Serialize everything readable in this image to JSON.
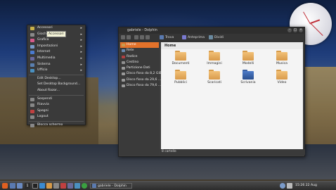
{
  "menu": {
    "items": [
      {
        "label": "Accessori",
        "submenu": true,
        "icon": "accessories-icon",
        "color": "#c9b24a"
      },
      {
        "label": "Giochi",
        "submenu": true,
        "icon": "games-icon",
        "color": "#8a8a8a"
      },
      {
        "label": "Grafica",
        "submenu": true,
        "icon": "graphics-icon",
        "color": "#d45a8a"
      },
      {
        "label": "Impostazioni",
        "submenu": true,
        "icon": "settings-icon",
        "color": "#7a9ac8"
      },
      {
        "label": "Internet",
        "submenu": true,
        "icon": "internet-icon",
        "color": "#4a7ad0"
      },
      {
        "label": "Multimedia",
        "submenu": true,
        "icon": "multimedia-icon",
        "color": "#6a6aa0"
      },
      {
        "label": "Sistema",
        "submenu": true,
        "icon": "system-icon",
        "color": "#5a80b0"
      },
      {
        "label": "Ufficio",
        "submenu": true,
        "icon": "office-icon",
        "color": "#4a90c0"
      }
    ],
    "extra_items": [
      "Edit Desktop...",
      "Set Desktop Background...",
      "About Razor..."
    ],
    "session_items": [
      {
        "label": "Sospendi",
        "icon": "suspend-icon"
      },
      {
        "label": "Riavvia",
        "icon": "restart-icon"
      },
      {
        "label": "Spegni",
        "icon": "shutdown-icon"
      },
      {
        "label": "Logout",
        "icon": "logout-icon"
      }
    ],
    "lock_item": {
      "label": "Blocca schermo",
      "icon": "lock-icon"
    },
    "tooltip": "Accessori"
  },
  "window": {
    "title": "gabriele - Dolphin",
    "toolbar": {
      "search": "Trova",
      "preview": "Anteprima",
      "split": "Dividi"
    },
    "sidebar": [
      {
        "label": "Home",
        "selected": true
      },
      {
        "label": "Rete",
        "selected": false
      },
      {
        "label": "Radice",
        "selected": false
      },
      {
        "label": "Cestino",
        "selected": false
      },
      {
        "label": "Partizione Dati",
        "selected": false
      },
      {
        "label": "Disco fisso da 8,2 GiB",
        "selected": false
      },
      {
        "label": "Disco fisso da 29,6 ...",
        "selected": false
      },
      {
        "label": "Disco fisso da 79,6 ...",
        "selected": false
      }
    ],
    "breadcrumb": "Home",
    "files": [
      {
        "name": "Documenti",
        "special": false
      },
      {
        "name": "Immagini",
        "special": false
      },
      {
        "name": "Modelli",
        "special": false
      },
      {
        "name": "Musica",
        "special": false
      },
      {
        "name": "Pubblici",
        "special": false
      },
      {
        "name": "Scaricati",
        "special": false
      },
      {
        "name": "Scrivania",
        "special": true
      },
      {
        "name": "Video",
        "special": false
      }
    ],
    "status": "8 cartelle"
  },
  "taskbar": {
    "task_label": "gabriele - Dolphin",
    "workspace": "1",
    "clock": "15:26 22 Aug"
  }
}
